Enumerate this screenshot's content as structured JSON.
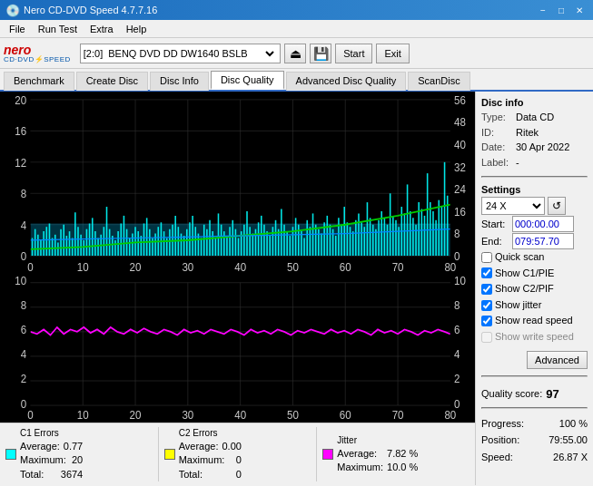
{
  "title_bar": {
    "title": "Nero CD-DVD Speed 4.7.7.16",
    "controls": [
      "−",
      "□",
      "✕"
    ]
  },
  "menu": {
    "items": [
      "File",
      "Run Test",
      "Extra",
      "Help"
    ]
  },
  "toolbar": {
    "drive_label": "[2:0]",
    "drive_name": "BENQ DVD DD DW1640 BSLB",
    "start_label": "Start",
    "exit_label": "Exit"
  },
  "tabs": {
    "items": [
      "Benchmark",
      "Create Disc",
      "Disc Info",
      "Disc Quality",
      "Advanced Disc Quality",
      "ScanDisc"
    ],
    "active": 3
  },
  "disc_info": {
    "section_title": "Disc info",
    "type_label": "Type:",
    "type_value": "Data CD",
    "id_label": "ID:",
    "id_value": "Ritek",
    "date_label": "Date:",
    "date_value": "30 Apr 2022",
    "label_label": "Label:",
    "label_value": "-"
  },
  "settings": {
    "section_title": "Settings",
    "speed": "24 X",
    "start_label": "Start:",
    "start_value": "000:00.00",
    "end_label": "End:",
    "end_value": "079:57.70",
    "quick_scan_label": "Quick scan",
    "quick_scan_checked": false,
    "show_c1pie_label": "Show C1/PIE",
    "show_c1pie_checked": true,
    "show_c2pif_label": "Show C2/PIF",
    "show_c2pif_checked": true,
    "show_jitter_label": "Show jitter",
    "show_jitter_checked": true,
    "show_read_speed_label": "Show read speed",
    "show_read_speed_checked": true,
    "show_write_speed_label": "Show write speed",
    "show_write_speed_checked": false,
    "advanced_btn": "Advanced"
  },
  "quality": {
    "score_label": "Quality score:",
    "score_value": "97"
  },
  "progress": {
    "progress_label": "Progress:",
    "progress_value": "100 %",
    "position_label": "Position:",
    "position_value": "79:55.00",
    "speed_label": "Speed:",
    "speed_value": "26.87 X"
  },
  "chart": {
    "upper": {
      "y_left_max": 20,
      "y_right_max": 56,
      "x_max": 80,
      "y_left_ticks": [
        0,
        4,
        8,
        12,
        16,
        20
      ],
      "y_right_ticks": [
        0,
        8,
        16,
        24,
        32,
        40,
        48,
        56
      ],
      "x_ticks": [
        0,
        10,
        20,
        30,
        40,
        50,
        60,
        70,
        80
      ]
    },
    "lower": {
      "y_left_max": 10,
      "y_right_max": 10,
      "x_max": 80
    }
  },
  "stats": {
    "c1": {
      "label": "C1 Errors",
      "color": "#00ffff",
      "avg_label": "Average:",
      "avg_value": "0.77",
      "max_label": "Maximum:",
      "max_value": "20",
      "total_label": "Total:",
      "total_value": "3674"
    },
    "c2": {
      "label": "C2 Errors",
      "color": "#ffff00",
      "avg_label": "Average:",
      "avg_value": "0.00",
      "max_label": "Maximum:",
      "max_value": "0",
      "total_label": "Total:",
      "total_value": "0"
    },
    "jitter": {
      "label": "Jitter",
      "color": "#ff00ff",
      "avg_label": "Average:",
      "avg_value": "7.82 %",
      "max_label": "Maximum:",
      "max_value": "10.0 %"
    }
  }
}
